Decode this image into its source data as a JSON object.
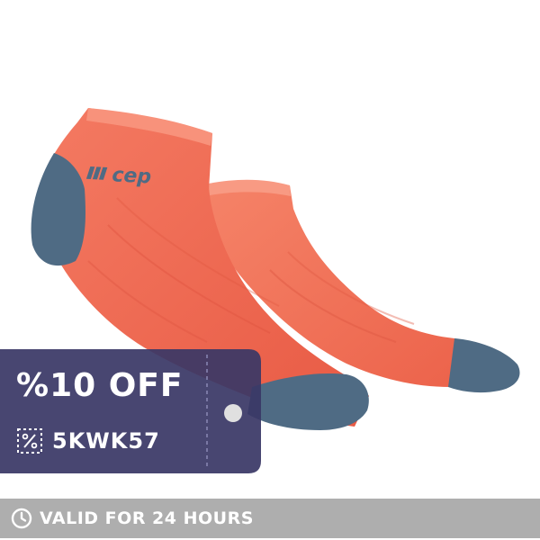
{
  "product": {
    "image_name": "coral-grey-low-cut-compression-socks",
    "brand_mark": "cep"
  },
  "coupon": {
    "discount_label": "%10 OFF",
    "code": "5KWK57",
    "code_icon": "discount-tag-icon",
    "background_color": "#3a3866"
  },
  "banner": {
    "icon": "clock-icon",
    "text": "VALID FOR 24 HOURS",
    "background_color": "#aeaeae"
  },
  "colors": {
    "sock_coral": "#f2674f",
    "sock_grey_blue": "#4f6b84"
  }
}
